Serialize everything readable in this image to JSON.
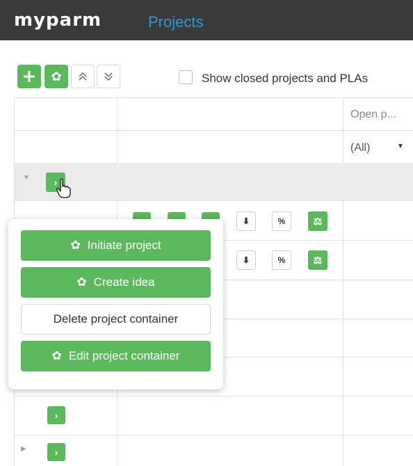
{
  "header": {
    "logo": "myparm",
    "title": "Projects",
    "background": "#3a3a3a",
    "title_color": "#2e9ad6"
  },
  "toolbar": {
    "add_icon": "plus-icon",
    "settings_icon": "gear-icon",
    "collapse_icon": "chevron-double-up-icon",
    "expand_icon": "chevron-double-down-icon",
    "show_closed_label": "Show closed projects and PLAs",
    "show_closed_checked": false
  },
  "table": {
    "column_header": "Open p...",
    "filter_value": "(All)"
  },
  "row_icons": {
    "download": "file-download-icon",
    "percent": "%",
    "balance": "scale-icon",
    "expand": "›"
  },
  "popup": {
    "items": [
      {
        "label": "Initiate project",
        "icon": "gear-icon",
        "style": "green"
      },
      {
        "label": "Create idea",
        "icon": "gear-icon",
        "style": "green"
      },
      {
        "label": "Delete project container",
        "icon": "",
        "style": "white"
      },
      {
        "label": "Edit project container",
        "icon": "gear-icon",
        "style": "green"
      }
    ]
  },
  "colors": {
    "accent_green": "#5cb85c",
    "grid_line": "#e2e2e2",
    "selected_row": "#ebebeb"
  }
}
